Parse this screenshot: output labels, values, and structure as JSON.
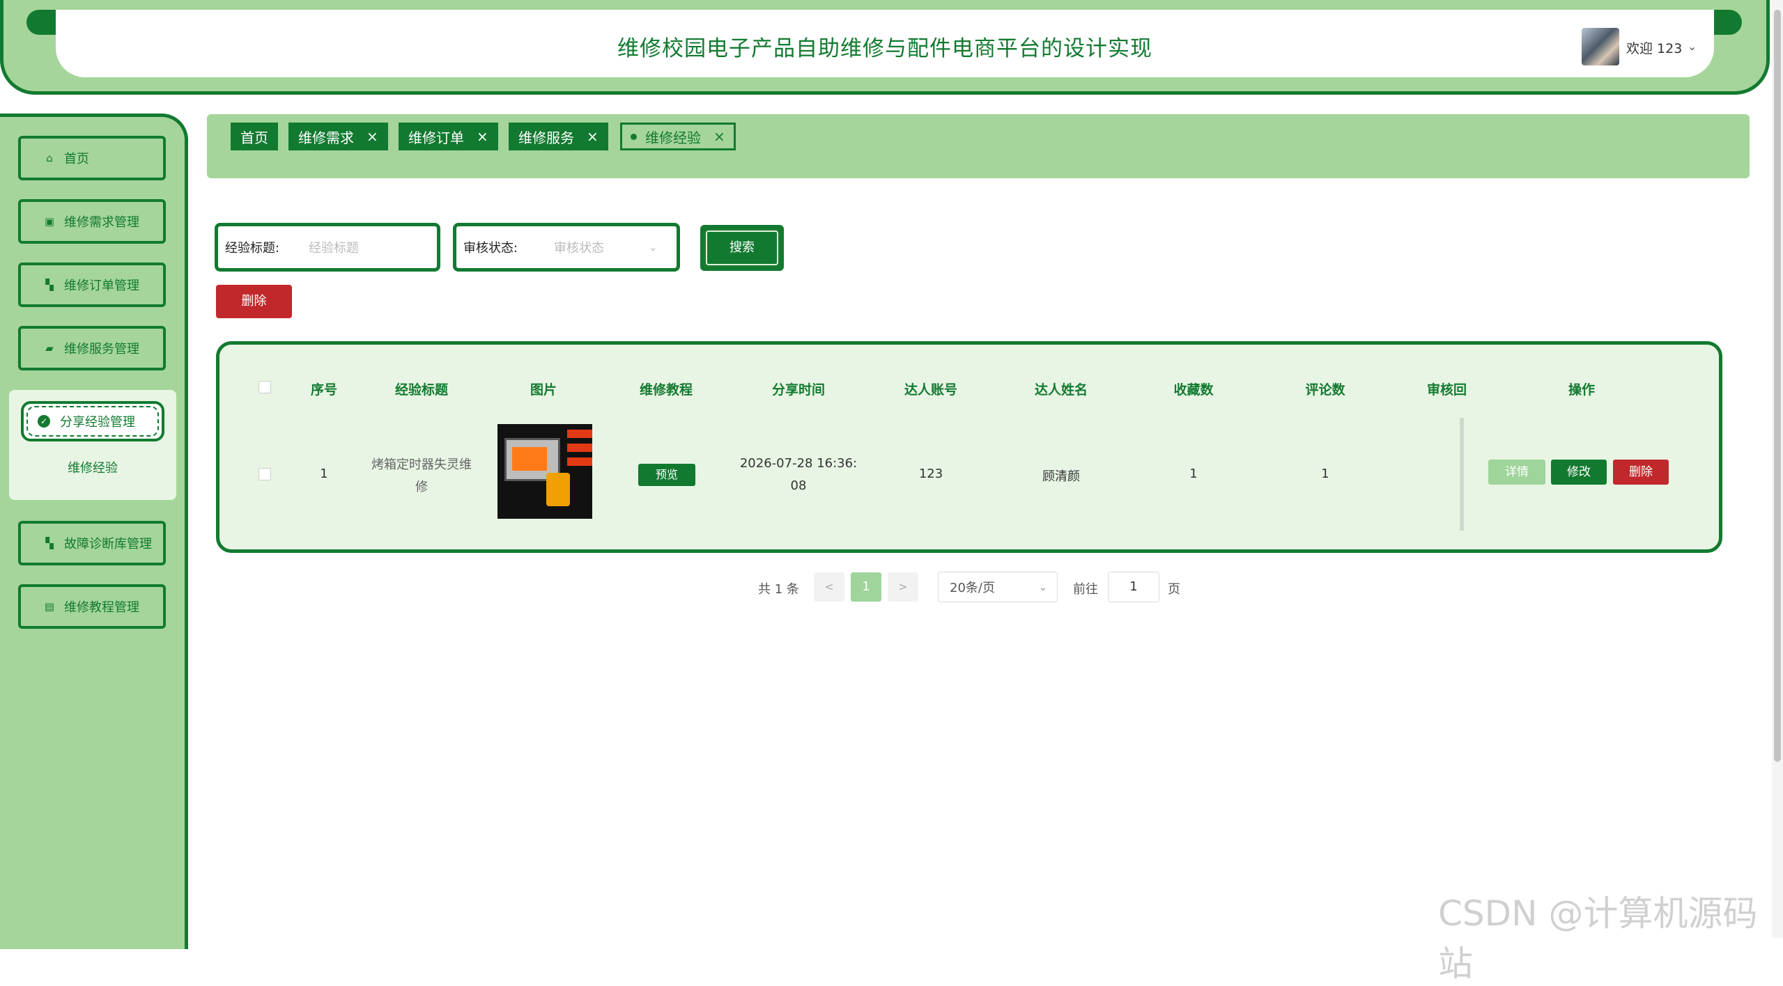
{
  "header": {
    "title": "维修校园电子产品自助维修与配件电商平台的设计实现",
    "welcome": "欢迎 123",
    "user_menu_icon": "chevron-down-icon"
  },
  "sidebar": {
    "items": [
      {
        "label": "首页",
        "icon": "home-icon"
      },
      {
        "label": "维修需求管理",
        "icon": "chip-icon"
      },
      {
        "label": "维修订单管理",
        "icon": "cart-icon"
      },
      {
        "label": "维修服务管理",
        "icon": "folder-icon"
      },
      {
        "label": "分享经验管理",
        "icon": "circle-icon",
        "active": true
      },
      {
        "label": "故障诊断库管理",
        "icon": "cart-icon"
      },
      {
        "label": "维修教程管理",
        "icon": "book-icon"
      }
    ],
    "active_submenu": "维修经验"
  },
  "tabs": [
    {
      "label": "首页",
      "closable": false
    },
    {
      "label": "维修需求",
      "closable": true
    },
    {
      "label": "维修订单",
      "closable": true
    },
    {
      "label": "维修服务",
      "closable": true
    },
    {
      "label": "维修经验",
      "closable": true,
      "active": true
    }
  ],
  "search": {
    "title_label": "经验标题:",
    "title_placeholder": "经验标题",
    "status_label": "审核状态:",
    "status_placeholder": "审核状态",
    "search_button": "搜索",
    "delete_button": "删除"
  },
  "table": {
    "columns": [
      "序号",
      "经验标题",
      "图片",
      "维修教程",
      "分享时间",
      "达人账号",
      "达人姓名",
      "收藏数",
      "评论数",
      "审核回",
      "操作"
    ],
    "rows": [
      {
        "index": "1",
        "title_line1": "烤箱定时器失灵维",
        "title_line2": "修",
        "tutorial_button": "预览",
        "time_line1": "2026-07-28 16:36:",
        "time_line2": "08",
        "account": "123",
        "name": "顾清颜",
        "favorites": "1",
        "comments": "1"
      }
    ],
    "actions": {
      "detail": "详情",
      "edit": "修改",
      "delete": "删除"
    }
  },
  "pagination": {
    "total": "共 1 条",
    "prev": "<",
    "current": "1",
    "next": ">",
    "page_size": "20条/页",
    "goto_label": "前往",
    "goto_value": "1",
    "page_suffix": "页"
  },
  "watermark": "CSDN @计算机源码站",
  "colors": {
    "primary": "#127a30",
    "light": "#a5d59b",
    "danger": "#c0282b"
  }
}
